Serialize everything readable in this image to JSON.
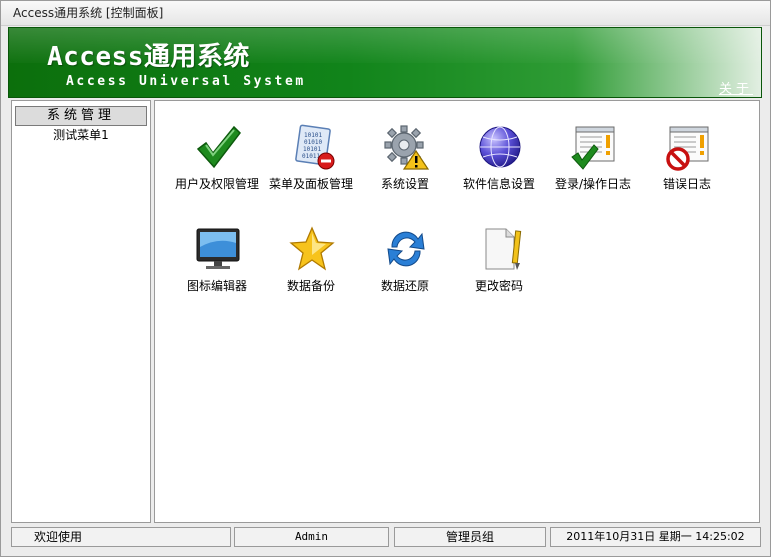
{
  "window": {
    "title": "Access通用系统 [控制面板]"
  },
  "banner": {
    "title": "Access通用系统",
    "subtitle": "Access Universal System",
    "close_label": "关于"
  },
  "sidebar": {
    "header": "系统管理",
    "items": [
      {
        "label": "测试菜单1"
      }
    ]
  },
  "main": {
    "tiles": [
      {
        "label": "用户及权限管理",
        "icon": "checkmark-icon"
      },
      {
        "label": "菜单及面板管理",
        "icon": "binary-document-icon"
      },
      {
        "label": "系统设置",
        "icon": "gear-warning-icon"
      },
      {
        "label": "软件信息设置",
        "icon": "globe-icon"
      },
      {
        "label": "登录/操作日志",
        "icon": "log-check-icon"
      },
      {
        "label": "错误日志",
        "icon": "log-error-icon"
      },
      {
        "label": "图标编辑器",
        "icon": "monitor-icon"
      },
      {
        "label": "数据备份",
        "icon": "star-icon"
      },
      {
        "label": "数据还原",
        "icon": "refresh-icon"
      },
      {
        "label": "更改密码",
        "icon": "document-pencil-icon"
      }
    ]
  },
  "status": {
    "welcome": "欢迎使用",
    "user": "Admin",
    "group": "管理员组",
    "datetime": "2011年10月31日 星期一 14:25:02"
  },
  "colors": {
    "banner_green": "#11841a",
    "banner_light": "#e2efe2"
  }
}
